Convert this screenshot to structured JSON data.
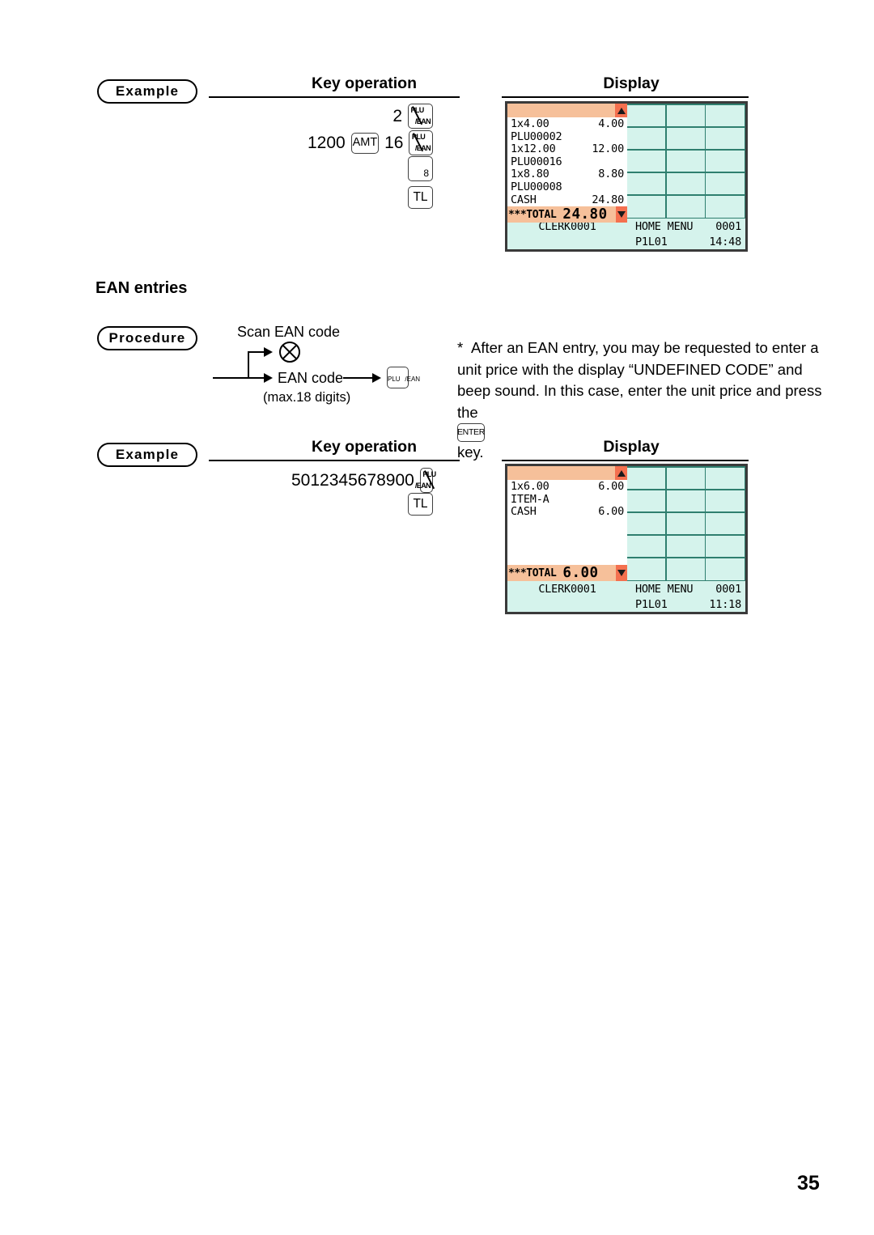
{
  "page": {
    "number": "35"
  },
  "section": {
    "heading": "EAN entries"
  },
  "badges": {
    "example": "Example",
    "procedure": "Procedure"
  },
  "column_headers": {
    "key_operation": "Key operation",
    "display": "Display"
  },
  "example1": {
    "keys": {
      "qty": "2",
      "amount": "1200",
      "amt_key": "AMT",
      "plu_code": "16",
      "plu_key_top": "PLU",
      "plu_key_bottom": "/EAN",
      "dept_key": "8",
      "total_key": "TL"
    },
    "display": {
      "lines": [
        {
          "label": "1x4.00",
          "amount": "4.00"
        },
        {
          "label": "PLU00002",
          "amount": ""
        },
        {
          "label": "1x12.00",
          "amount": "12.00"
        },
        {
          "label": "PLU00016",
          "amount": ""
        },
        {
          "label": "1x8.80",
          "amount": "8.80"
        },
        {
          "label": "PLU00008",
          "amount": ""
        },
        {
          "label": "CASH",
          "amount": "24.80"
        }
      ],
      "total_label": "***TOTAL",
      "total_value": "24.80",
      "status": {
        "clerk": "CLERK0001",
        "menu": "HOME MENU",
        "counter": "0001",
        "level": "P1L01",
        "time": "14:48"
      }
    }
  },
  "procedure": {
    "scan_label": "Scan EAN code",
    "ean_label": "EAN code",
    "ean_sub": "(max.18 digits)",
    "plu_key_top": "PLU",
    "plu_key_bottom": "/EAN"
  },
  "note": {
    "marker": "*",
    "text": "After an EAN entry, you may be requested to enter a unit price with the display “UNDEFINED CODE” and beep sound.  In this case, enter the unit price and press the",
    "enter_key": "ENTER",
    "tail": "key."
  },
  "example2": {
    "keys": {
      "ean_code": "5012345678900",
      "plu_key_top": "PLU",
      "plu_key_bottom": "/EAN",
      "total_key": "TL"
    },
    "display": {
      "lines": [
        {
          "label": "1x6.00",
          "amount": "6.00"
        },
        {
          "label": "ITEM-A",
          "amount": ""
        },
        {
          "label": "CASH",
          "amount": "6.00"
        }
      ],
      "total_label": "***TOTAL",
      "total_value": "6.00",
      "status": {
        "clerk": "CLERK0001",
        "menu": "HOME MENU",
        "counter": "0001",
        "level": "P1L01",
        "time": "11:18"
      }
    }
  },
  "colors": {
    "header_bar": "#f6c09a",
    "arrow_box": "#f4704f",
    "key_cell": "#d5f3ec",
    "key_grid_border": "#2f7f6f",
    "frame": "#3a3a3a"
  }
}
